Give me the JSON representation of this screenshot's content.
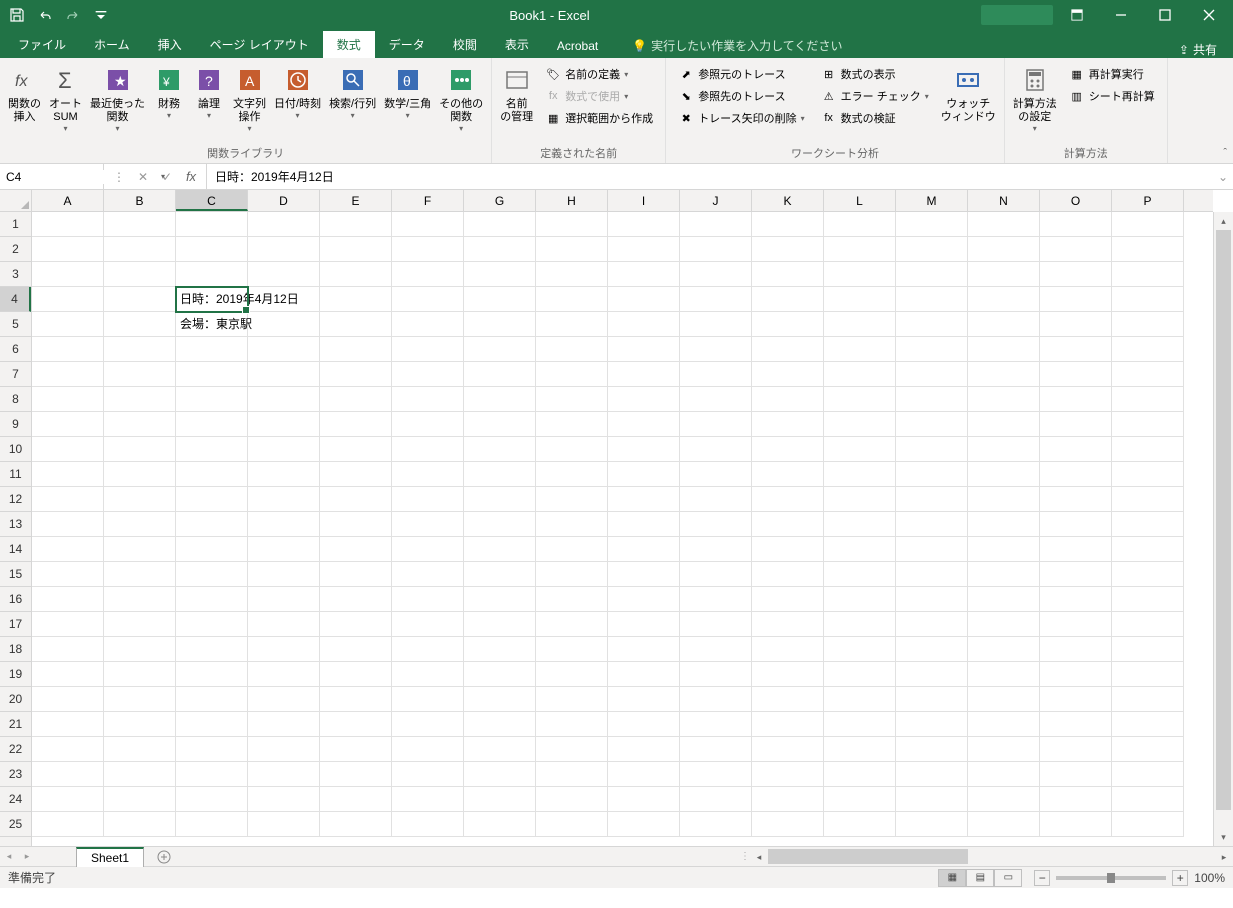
{
  "title": "Book1 - Excel",
  "qat": {
    "save": "保存",
    "undo": "元に戻す",
    "redo": "やり直し"
  },
  "tabs": [
    "ファイル",
    "ホーム",
    "挿入",
    "ページ レイアウト",
    "数式",
    "データ",
    "校閲",
    "表示",
    "Acrobat"
  ],
  "active_tab": 4,
  "tell_me": "実行したい作業を入力してください",
  "share": "共有",
  "ribbon": {
    "groups": [
      {
        "label": "関数ライブラリ",
        "items": [
          "関数の\n挿入",
          "オート\nSUM",
          "最近使った\n関数",
          "財務",
          "論理",
          "文字列\n操作",
          "日付/時刻",
          "検索/行列",
          "数学/三角",
          "その他の\n関数"
        ]
      },
      {
        "label": "定義された名前",
        "big": "名前\nの管理",
        "small": [
          "名前の定義",
          "数式で使用",
          "選択範囲から作成"
        ]
      },
      {
        "label": "ワークシート分析",
        "col1": [
          "参照元のトレース",
          "参照先のトレース",
          "トレース矢印の削除"
        ],
        "col2": [
          "数式の表示",
          "エラー チェック",
          "数式の検証"
        ],
        "big": "ウォッチ\nウィンドウ"
      },
      {
        "label": "計算方法",
        "big": "計算方法\nの設定",
        "small": [
          "再計算実行",
          "シート再計算"
        ]
      }
    ]
  },
  "namebox": "C4",
  "formula": "日時：2019年4月12日",
  "columns": [
    "A",
    "B",
    "C",
    "D",
    "E",
    "F",
    "G",
    "H",
    "I",
    "J",
    "K",
    "L",
    "M",
    "N",
    "O",
    "P"
  ],
  "rows": 25,
  "selected": {
    "row": 4,
    "col": "C"
  },
  "cells": {
    "C4": "日時：2019年4月12日",
    "C5": "会場：東京駅"
  },
  "sheet": "Sheet1",
  "status": "準備完了",
  "zoom": "100%"
}
